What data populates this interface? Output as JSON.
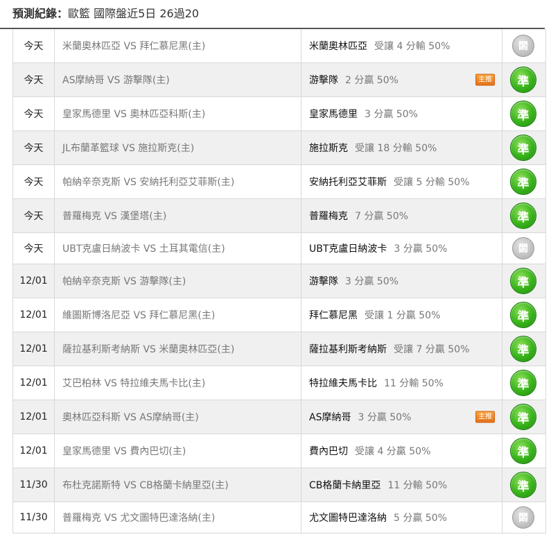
{
  "header": {
    "title": "預測紀錄：",
    "subtitle": "歐籃 國際盤近5日 26過20"
  },
  "labels": {
    "recommend_badge": "主推",
    "result_win": "準",
    "result_pending": "閟"
  },
  "rows": [
    {
      "date": "今天",
      "match": "米蘭奧林匹亞 VS 拜仁慕尼黑(主)",
      "pick": "米蘭奧林匹亞",
      "detail": "受讓 4 分輸 50%",
      "badge": false,
      "result": "pending"
    },
    {
      "date": "今天",
      "match": "AS摩納哥 VS 游擊隊(主)",
      "pick": "游擊隊",
      "detail": "2 分贏 50%",
      "badge": true,
      "result": "win"
    },
    {
      "date": "今天",
      "match": "皇家馬德里 VS 奧林匹亞科斯(主)",
      "pick": "皇家馬德里",
      "detail": "3 分贏 50%",
      "badge": false,
      "result": "win"
    },
    {
      "date": "今天",
      "match": "JL布蘭革籃球 VS 施拉斯克(主)",
      "pick": "施拉斯克",
      "detail": "受讓 18 分輸 50%",
      "badge": false,
      "result": "win"
    },
    {
      "date": "今天",
      "match": "帕納辛奈克斯 VS 安納托利亞艾菲斯(主)",
      "pick": "安納托利亞艾菲斯",
      "detail": "受讓 5 分輸 50%",
      "badge": false,
      "result": "win"
    },
    {
      "date": "今天",
      "match": "普羅梅克 VS 漢堡塔(主)",
      "pick": "普羅梅克",
      "detail": "7 分贏 50%",
      "badge": false,
      "result": "win"
    },
    {
      "date": "今天",
      "match": "UBT克盧日納波卡 VS 土耳其電信(主)",
      "pick": "UBT克盧日納波卡",
      "detail": "3 分贏 50%",
      "badge": false,
      "result": "pending"
    },
    {
      "date": "12/01",
      "match": "帕納辛奈克斯 VS 游擊隊(主)",
      "pick": "游擊隊",
      "detail": "3 分贏 50%",
      "badge": false,
      "result": "win"
    },
    {
      "date": "12/01",
      "match": "維圖斯博洛尼亞 VS 拜仁慕尼黑(主)",
      "pick": "拜仁慕尼黑",
      "detail": "受讓 1 分贏 50%",
      "badge": false,
      "result": "win"
    },
    {
      "date": "12/01",
      "match": "薩拉基利斯考納斯 VS 米蘭奧林匹亞(主)",
      "pick": "薩拉基利斯考納斯",
      "detail": "受讓 7 分贏 50%",
      "badge": false,
      "result": "win"
    },
    {
      "date": "12/01",
      "match": "艾巴柏林 VS 特拉維夫馬卡比(主)",
      "pick": "特拉維夫馬卡比",
      "detail": "11 分輸 50%",
      "badge": false,
      "result": "win"
    },
    {
      "date": "12/01",
      "match": "奧林匹亞科斯 VS AS摩納哥(主)",
      "pick": "AS摩納哥",
      "detail": "3 分贏 50%",
      "badge": true,
      "result": "win"
    },
    {
      "date": "12/01",
      "match": "皇家馬德里 VS 費內巴切(主)",
      "pick": "費內巴切",
      "detail": "受讓 4 分贏 50%",
      "badge": false,
      "result": "win"
    },
    {
      "date": "11/30",
      "match": "布杜克諾斯特 VS CB格蘭卡納里亞(主)",
      "pick": "CB格蘭卡納里亞",
      "detail": "11 分輸 50%",
      "badge": false,
      "result": "win"
    },
    {
      "date": "11/30",
      "match": "普羅梅克 VS 尤文圖特巴達洛納(主)",
      "pick": "尤文圖特巴達洛納",
      "detail": "5 分贏 50%",
      "badge": false,
      "result": "pending"
    }
  ]
}
